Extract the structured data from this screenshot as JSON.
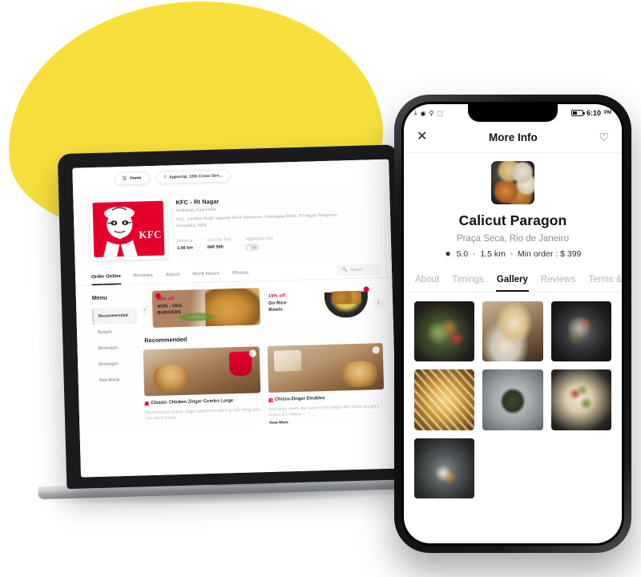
{
  "scene": {
    "background_color": "#ffffff",
    "blob_color": "#F7E03C"
  },
  "laptop": {
    "device": "laptop-mockup",
    "web": {
      "topbar": {
        "home_chip": {
          "icon": "home-icon",
          "label": "Home"
        },
        "location_chip": {
          "icon": "location-pin-icon",
          "label": "Appscrip, 10th Cross Stre..."
        }
      },
      "restaurant": {
        "logo_alt": "KFC",
        "logo_wordmark": "KFC",
        "name": "KFC - Rt Nagar",
        "cuisine": "American, Fast Food",
        "address": "KFC, 1st Main Road, opposite BATA Showroom, Krishnappa Block, RT Nagar, Bengaluru, Karnataka, India",
        "stats": [
          {
            "label": "Distance",
            "value": "1.06 km",
            "type": "text"
          },
          {
            "label": "Cost For Two",
            "value": "INR 500",
            "type": "text"
          },
          {
            "label": "Vegetarian only",
            "value": "",
            "type": "toggle",
            "toggle_on": false
          }
        ]
      },
      "tabs": [
        {
          "label": "Order Online",
          "active": true
        },
        {
          "label": "Reviews",
          "active": false
        },
        {
          "label": "About",
          "active": false
        },
        {
          "label": "Work Hours",
          "active": false
        },
        {
          "label": "Photos",
          "active": false
        }
      ],
      "search": {
        "icon": "search-icon",
        "placeholder": "Search",
        "value": ""
      },
      "menu": {
        "heading": "Menu",
        "items": [
          {
            "label": "Recommended",
            "active": true
          },
          {
            "label": "Burgers",
            "active": false
          },
          {
            "label": "Beverages",
            "active": false
          },
          {
            "label": "Beverages",
            "active": false
          },
          {
            "label": "Rice Bowls",
            "active": false
          }
        ]
      },
      "carousel": {
        "prev_icon": "chevron-left-icon",
        "next_icon": "chevron-right-icon",
        "banners": [
          {
            "off": "30% off",
            "line1": "NON - VEG",
            "line2": "BURGERS",
            "badge": "kfc-badge-icon"
          },
          {
            "off": "19% off",
            "line1": "On Rice",
            "line2": "Bowls",
            "badge": "kfc-badge-icon"
          }
        ]
      },
      "recommended": {
        "heading": "Recommended",
        "items": [
          {
            "title": "Classic Chicken Zinger Combo Large",
            "description": "Maximise your Classic Zinger experience with 4 pc Hot Wings and 1 pc Hot & Crispy.",
            "veg_mark": "non-veg-mark-icon",
            "favorite_icon": "heart-icon",
            "view_more": ""
          },
          {
            "title": "Chizza-Zinger Doubles",
            "description": "Best-seller meets star-seller in this unique offer where you get 1 Chizza & 1 Classic...",
            "veg_mark": "non-veg-mark-icon",
            "favorite_icon": "heart-icon",
            "view_more": "View More"
          }
        ]
      }
    }
  },
  "phone": {
    "device": "smartphone-mockup",
    "statusbar": {
      "left_icons": [
        "download-icon",
        "vibrate-icon",
        "location-icon",
        "bluetooth-icon"
      ],
      "battery_icon": "battery-icon",
      "time": "6:10",
      "meridiem": "PM"
    },
    "appbar": {
      "close_icon": "close-icon",
      "title": "More Info",
      "favorite_icon": "heart-icon"
    },
    "restaurant": {
      "image_alt": "restaurant-thumbnail",
      "name": "Calicut Paragon",
      "location": "Praça Seca, Rio de Janeiro",
      "star_icon": "star-icon",
      "rating": "5.0",
      "distance": "1.5 km",
      "min_order": "Min order : $ 399",
      "separator": "•"
    },
    "tabs": [
      {
        "label": "About",
        "active": false
      },
      {
        "label": "Timings",
        "active": false
      },
      {
        "label": "Gallery",
        "active": true
      },
      {
        "label": "Reviews",
        "active": false
      },
      {
        "label": "Terms & condi",
        "active": false
      }
    ],
    "gallery": {
      "columns": 3,
      "images": [
        {
          "alt": "stir-fry-in-black-bowl"
        },
        {
          "alt": "breakfast-plate-with-newspaper"
        },
        {
          "alt": "roasted-vegetables-on-plate"
        },
        {
          "alt": "french-fries"
        },
        {
          "alt": "avocado-toast-with-poached-egg"
        },
        {
          "alt": "pizza-with-vegetables"
        },
        {
          "alt": "skillet-dish-with-spoon"
        }
      ]
    }
  }
}
